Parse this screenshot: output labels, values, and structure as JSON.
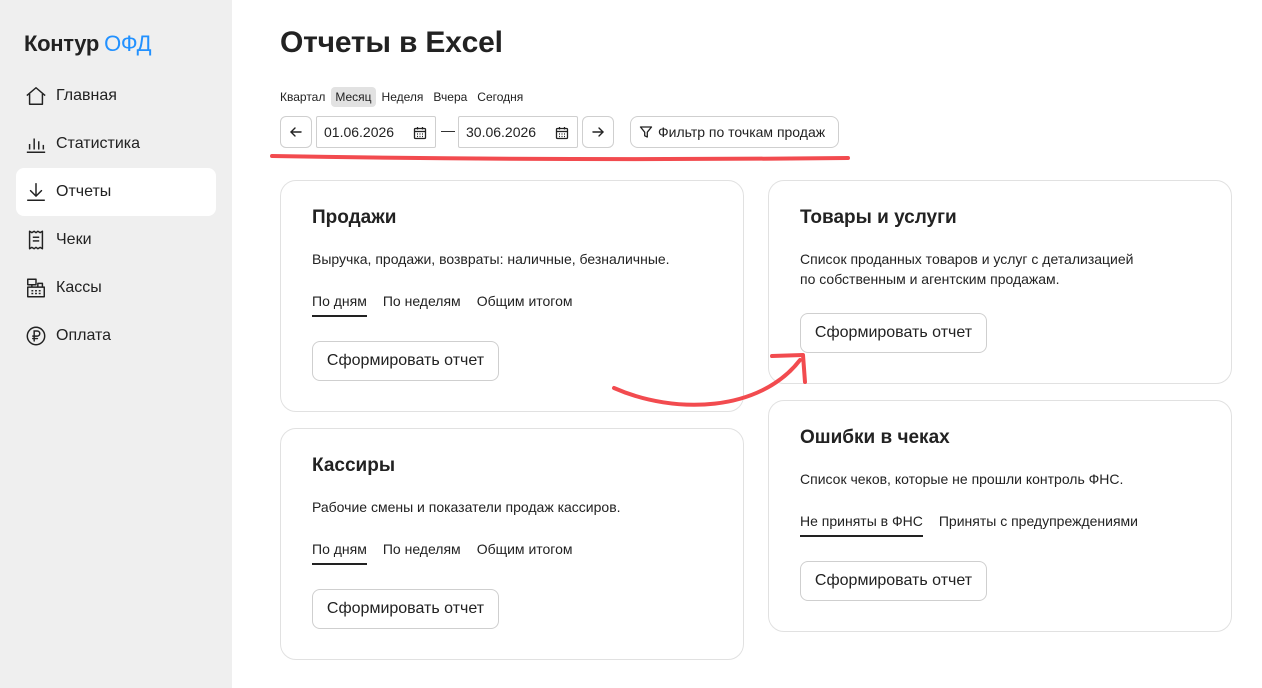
{
  "brand": {
    "main": "Контур",
    "accent": "ОФД"
  },
  "sidebar": {
    "items": [
      {
        "label": "Главная",
        "icon": "home-icon"
      },
      {
        "label": "Статистика",
        "icon": "bar-chart-icon"
      },
      {
        "label": "Отчеты",
        "icon": "download-icon",
        "active": true
      },
      {
        "label": "Чеки",
        "icon": "receipt-icon"
      },
      {
        "label": "Кассы",
        "icon": "cash-register-icon"
      },
      {
        "label": "Оплата",
        "icon": "ruble-icon"
      }
    ]
  },
  "page": {
    "title": "Отчеты в Excel"
  },
  "periods": [
    "Квартал",
    "Месяц",
    "Неделя",
    "Вчера",
    "Сегодня"
  ],
  "active_period": "Месяц",
  "date_range": {
    "from": "01.06.2026",
    "to": "30.06.2026",
    "separator": "—"
  },
  "filter": {
    "label": "Фильтр по точкам продаж"
  },
  "cards": {
    "sales": {
      "title": "Продажи",
      "description": "Выручка, продажи, возвраты: наличные, безналичные.",
      "tabs": [
        "По дням",
        "По неделям",
        "Общим итогом"
      ],
      "button": "Сформировать отчет"
    },
    "goods": {
      "title": "Товары и услуги",
      "description_line1": "Список проданных товаров и услуг с детализацией",
      "description_line2": "по собственным и агентским продажам.",
      "button": "Сформировать отчет"
    },
    "cashiers": {
      "title": "Кассиры",
      "description": "Рабочие смены и показатели продаж кассиров.",
      "tabs": [
        "По дням",
        "По неделям",
        "Общим итогом"
      ],
      "button": "Сформировать отчет"
    },
    "errors": {
      "title": "Ошибки в чеках",
      "description": "Список чеков, которые не прошли контроль ФНС.",
      "tabs": [
        "Не приняты в ФНС",
        "Приняты с предупреждениями"
      ],
      "button": "Сформировать отчет"
    }
  },
  "colors": {
    "accent": "#2291ff",
    "annotation": "#f24b4f",
    "sidebar_bg": "#efefef"
  }
}
